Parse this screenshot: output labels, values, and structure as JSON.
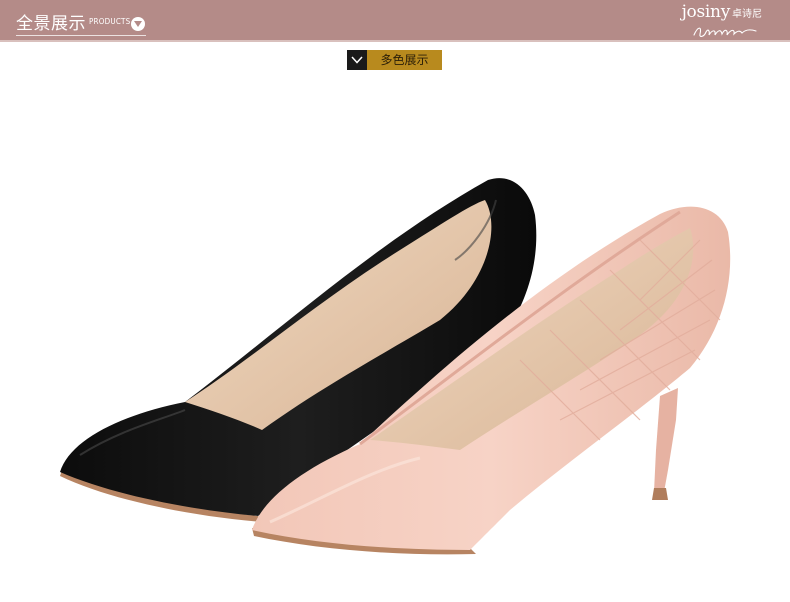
{
  "header": {
    "title_cn": "全景展示",
    "title_en": "PRODUCTS",
    "brand_name": "josiny",
    "brand_cn": "卓诗尼",
    "bg_color": "#b48b88"
  },
  "section": {
    "tag_label": "多色展示",
    "tag_color": "#b88a1e"
  },
  "icons": {
    "toggle": "chevron-down-icon",
    "tag": "check-icon"
  },
  "products": {
    "colors": [
      "black",
      "pink"
    ]
  }
}
